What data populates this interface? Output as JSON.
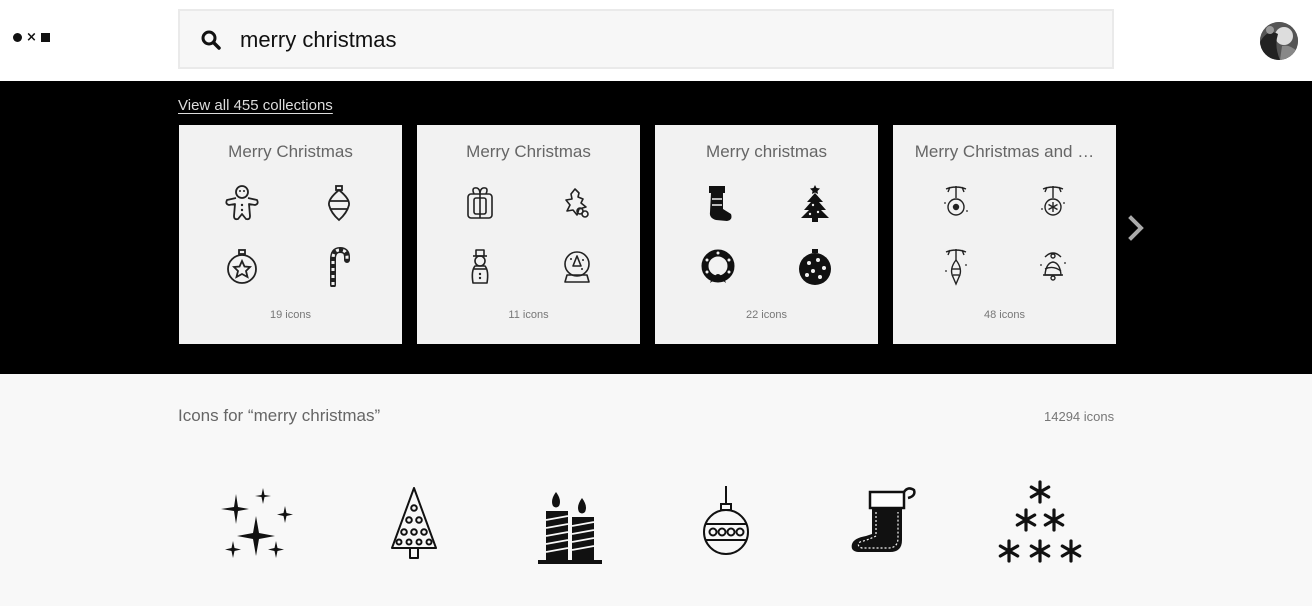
{
  "header": {
    "logo": {
      "dot": "●",
      "x": "×",
      "square": "■"
    },
    "search": {
      "value": "merry christmas",
      "icon": "search-icon"
    },
    "avatar": "user-avatar"
  },
  "collections": {
    "view_all": "View all 455 collections",
    "cards": [
      {
        "title": "Merry Christmas",
        "count": "19 icons",
        "icons": [
          "gingerbread-man-icon",
          "ornament-drop-icon",
          "ornament-star-icon",
          "candy-cane-icon"
        ]
      },
      {
        "title": "Merry Christmas",
        "count": "11 icons",
        "icons": [
          "gift-box-icon",
          "holly-icon",
          "snowman-icon",
          "snow-globe-icon"
        ]
      },
      {
        "title": "Merry christmas",
        "count": "22 icons",
        "icons": [
          "stocking-icon",
          "christmas-tree-icon",
          "wreath-icon",
          "bauble-icon"
        ]
      },
      {
        "title": "Merry Christmas and …",
        "count": "48 icons",
        "icons": [
          "hanging-ornament-icon",
          "hanging-ornament-snowflake-icon",
          "hanging-ornament-long-icon",
          "hanging-bell-icon"
        ]
      }
    ],
    "next_icon": "chevron-right-icon"
  },
  "results": {
    "title": "Icons for “merry christmas”",
    "count": "14294 icons",
    "icons": [
      "sparkles-icon",
      "christmas-tree-outline-icon",
      "candles-icon",
      "bauble-outline-icon",
      "stocking-icon",
      "snowflake-tree-icon"
    ]
  }
}
